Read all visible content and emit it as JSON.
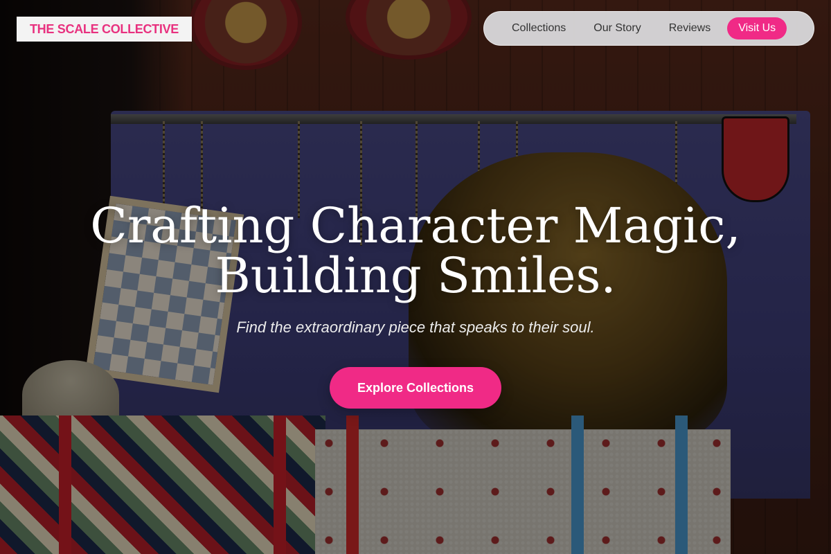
{
  "brand": {
    "logo_text": "THE SCALE COLLECTIVE",
    "accent_color": "#f02a86"
  },
  "nav": {
    "links": [
      "Collections",
      "Our Story",
      "Reviews"
    ],
    "cta_label": "Visit Us"
  },
  "hero": {
    "headline_line1": "Crafting Character Magic,",
    "headline_line2": "Building Smiles.",
    "subheadline": "Find the extraordinary piece that speaks to their soul.",
    "cta_label": "Explore Collections",
    "background_image": "market-stall-with-crafts-photo"
  }
}
